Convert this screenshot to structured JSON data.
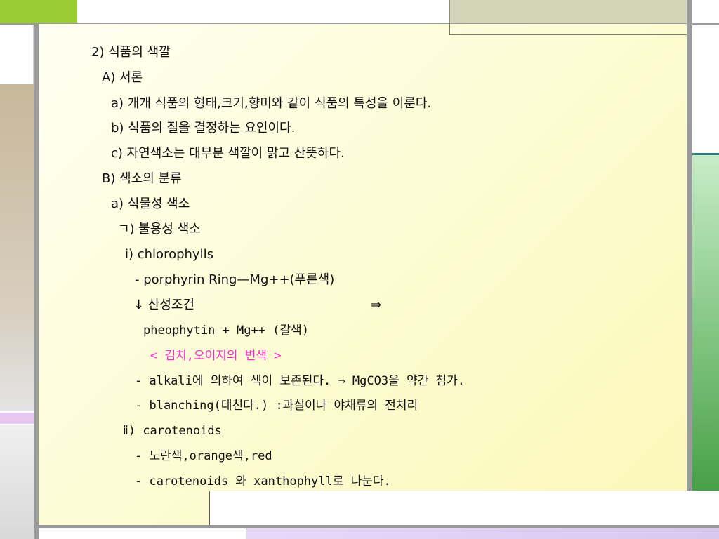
{
  "colors": {
    "green": "#9acd32",
    "grey": "#9a9a9a",
    "khaki": "#d4d4b8",
    "tan": "#c4b496",
    "lavender": "#e8c8f0",
    "teal": "#2f7f7f",
    "text": "#111111",
    "highlight": "#ff22cc"
  },
  "lines": [
    "2) 식품의 색깔",
    "A) 서론",
    "a) 개개 식품의 형태,크기,향미와 같이 식품의 특성을 이룬다.",
    "b) 식품의 질을 결정하는 요인이다.",
    "c) 자연색소는 대부분 색깔이 맑고 산뜻하다.",
    "B) 색소의 분류",
    "a) 식물성 색소",
    "ㄱ) 불용성 색소",
    "ⅰ) chlorophylls",
    "- porphyrin Ring—Mg++(푸른색)",
    "↓ 산성조건",
    "⇒",
    "pheophytin + Mg++  (갈색)",
    "< 김치,오이지의 변색 >",
    "- alkali에 의하여 색이 보존된다.  ⇒ MgCO3을 약간 첨가.",
    "- blanching(데친다.) :과실이나 야채류의 전처리",
    "ⅱ) carotenoids",
    "- 노란색,orange색,red",
    "- carotenoids 와 xanthophyll로 나눈다."
  ]
}
